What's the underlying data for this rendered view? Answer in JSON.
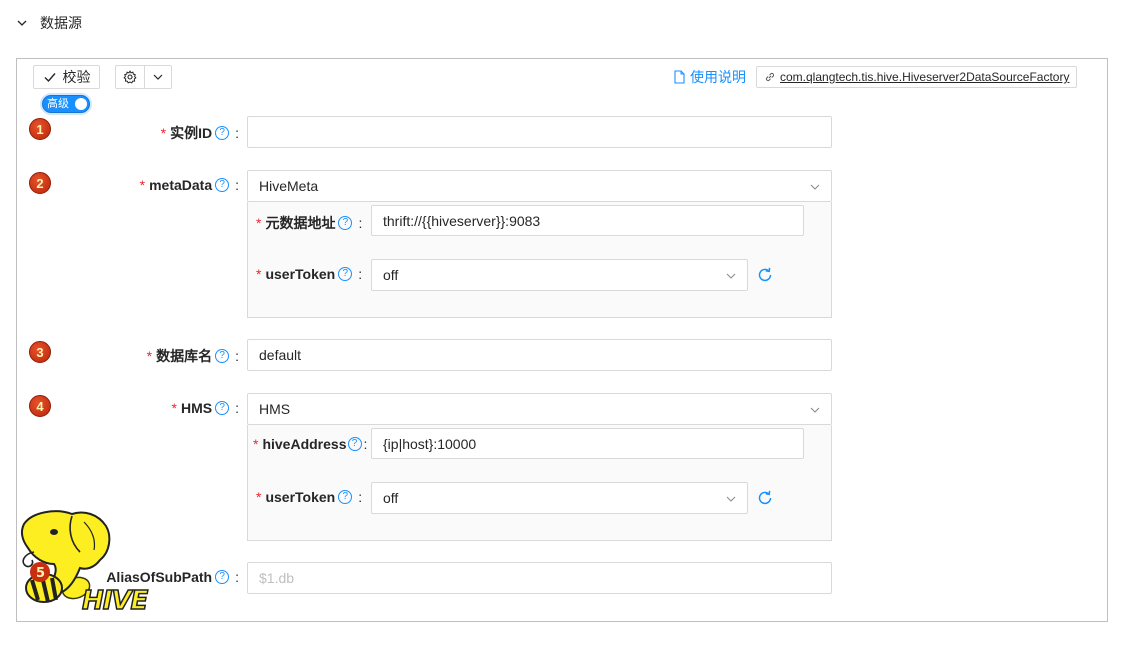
{
  "section": {
    "title": "数据源"
  },
  "toolbar": {
    "verify_label": "校验"
  },
  "toggle": {
    "label": "高级"
  },
  "doc_link": {
    "label": "使用说明"
  },
  "factory": {
    "label": "com.qlangtech.tis.hive.Hiveserver2DataSourceFactory"
  },
  "fields": [
    {
      "badge": "1",
      "label": "实例ID",
      "value": ""
    },
    {
      "badge": "2",
      "label": "metaData",
      "value": "HiveMeta",
      "sub": [
        {
          "label": "元数据地址",
          "value": "thrift://{{hiveserver}}:9083"
        },
        {
          "label": "userToken",
          "value": "off"
        }
      ]
    },
    {
      "badge": "3",
      "label": "数据库名",
      "value": "default"
    },
    {
      "badge": "4",
      "label": "HMS",
      "value": "HMS",
      "sub": [
        {
          "label": "hiveAddress",
          "value": "{ip|host}:10000"
        },
        {
          "label": "userToken",
          "value": "off"
        }
      ]
    },
    {
      "badge": "5",
      "label": "AliasOfSubPath",
      "placeholder": "$1.db"
    }
  ],
  "logo": {
    "text": "HIVE"
  },
  "colors": {
    "accent": "#1890ff",
    "required": "#f5222d",
    "badge": "#c7300f",
    "logo_yellow": "#fdee21"
  },
  "icons": {
    "collapse": "chevron-down-icon",
    "verify": "check-icon",
    "settings": "gear-icon",
    "doc": "document-icon",
    "link": "link-icon",
    "help": "question-circle-icon",
    "refresh": "refresh-icon"
  }
}
